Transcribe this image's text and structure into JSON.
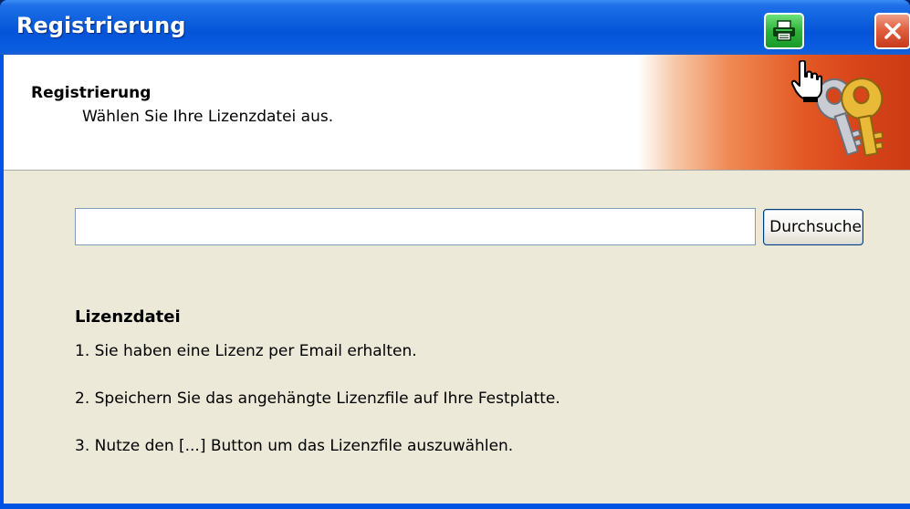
{
  "window": {
    "title": "Registrierung"
  },
  "titlebar": {
    "printer_icon": "printer-icon",
    "close_icon": "close-icon"
  },
  "header": {
    "title": "Registrierung",
    "subtitle": "Wählen Sie Ihre Lizenzdatei aus.",
    "icon": "keys-icon"
  },
  "file_input": {
    "value": ""
  },
  "browse_button": {
    "label": "Durchsuche"
  },
  "instructions": {
    "title": "Lizenzdatei",
    "steps": [
      "1. Sie haben eine Lizenz per Email erhalten.",
      "2. Speichern Sie das angehängte Lizenzfile auf Ihre Festplatte.",
      "3. Nutze den [...] Button um das Lizenzfile auszuwählen."
    ]
  },
  "colors": {
    "titlebar": "#0a5ddb",
    "header_accent": "#d8451a",
    "dialog_background": "#ece9d8",
    "printer_button": "#2cb33a",
    "close_button": "#e06040"
  }
}
